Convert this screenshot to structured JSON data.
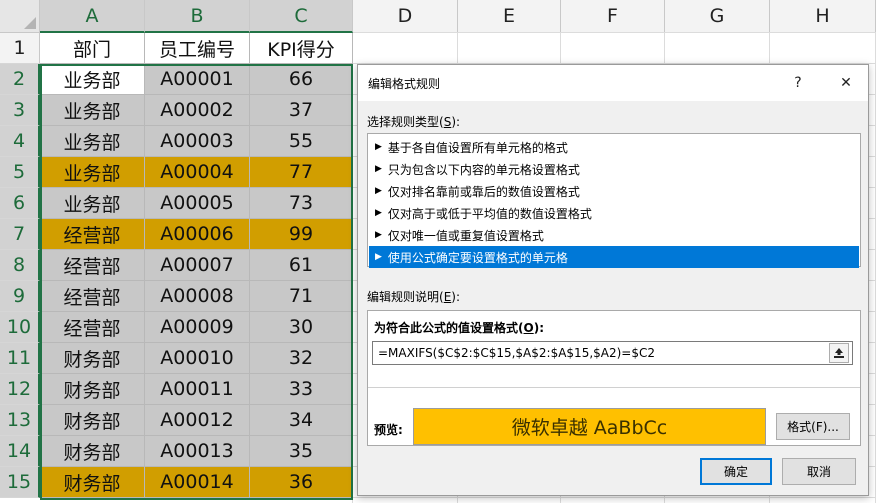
{
  "sheet": {
    "columns": [
      "A",
      "B",
      "C",
      "D",
      "E",
      "F",
      "G",
      "H"
    ],
    "rows": [
      "1",
      "2",
      "3",
      "4",
      "5",
      "6",
      "7",
      "8",
      "9",
      "10",
      "11",
      "12",
      "13",
      "14",
      "15"
    ],
    "header_row": [
      "部门",
      "员工编号",
      "KPI得分"
    ],
    "data": [
      {
        "dept": "业务部",
        "id": "A00001",
        "kpi": "66",
        "highlight": false,
        "first": true
      },
      {
        "dept": "业务部",
        "id": "A00002",
        "kpi": "37",
        "highlight": false
      },
      {
        "dept": "业务部",
        "id": "A00003",
        "kpi": "55",
        "highlight": false
      },
      {
        "dept": "业务部",
        "id": "A00004",
        "kpi": "77",
        "highlight": true
      },
      {
        "dept": "业务部",
        "id": "A00005",
        "kpi": "73",
        "highlight": false
      },
      {
        "dept": "经营部",
        "id": "A00006",
        "kpi": "99",
        "highlight": true
      },
      {
        "dept": "经营部",
        "id": "A00007",
        "kpi": "61",
        "highlight": false
      },
      {
        "dept": "经营部",
        "id": "A00008",
        "kpi": "71",
        "highlight": false
      },
      {
        "dept": "经营部",
        "id": "A00009",
        "kpi": "30",
        "highlight": false
      },
      {
        "dept": "财务部",
        "id": "A00010",
        "kpi": "32",
        "highlight": false
      },
      {
        "dept": "财务部",
        "id": "A00011",
        "kpi": "33",
        "highlight": false
      },
      {
        "dept": "财务部",
        "id": "A00012",
        "kpi": "34",
        "highlight": false
      },
      {
        "dept": "财务部",
        "id": "A00013",
        "kpi": "35",
        "highlight": false
      },
      {
        "dept": "财务部",
        "id": "A00014",
        "kpi": "36",
        "highlight": true
      }
    ],
    "colors": {
      "highlight": "#d19e00",
      "selected_fill": "#c8c8c8",
      "active_cell": "#ffffff",
      "selection_border": "#217346"
    }
  },
  "dialog": {
    "title": "编辑格式规则",
    "help_label": "?",
    "close_label": "✕",
    "select_type_label": "选择规则类型(",
    "select_type_key": "S",
    "select_type_suffix": "):",
    "rule_types": [
      "基于各自值设置所有单元格的格式",
      "只为包含以下内容的单元格设置格式",
      "仅对排名靠前或靠后的数值设置格式",
      "仅对高于或低于平均值的数值设置格式",
      "仅对唯一值或重复值设置格式",
      "使用公式确定要设置格式的单元格"
    ],
    "selected_rule_index": 5,
    "edit_desc_label": "编辑规则说明(",
    "edit_desc_key": "E",
    "edit_desc_suffix": "):",
    "formula_label": "为符合此公式的值设置格式(",
    "formula_key": "O",
    "formula_suffix": "):",
    "formula_value": "=MAXIFS($C$2:$C$15,$A$2:$A$15,$A2)=$C2",
    "preview_label": "预览:",
    "preview_text": "微软卓越  AaBbCc",
    "preview_color": "#ffc000",
    "format_button": "格式(F)...",
    "ok_button": "确定",
    "cancel_button": "取消"
  }
}
